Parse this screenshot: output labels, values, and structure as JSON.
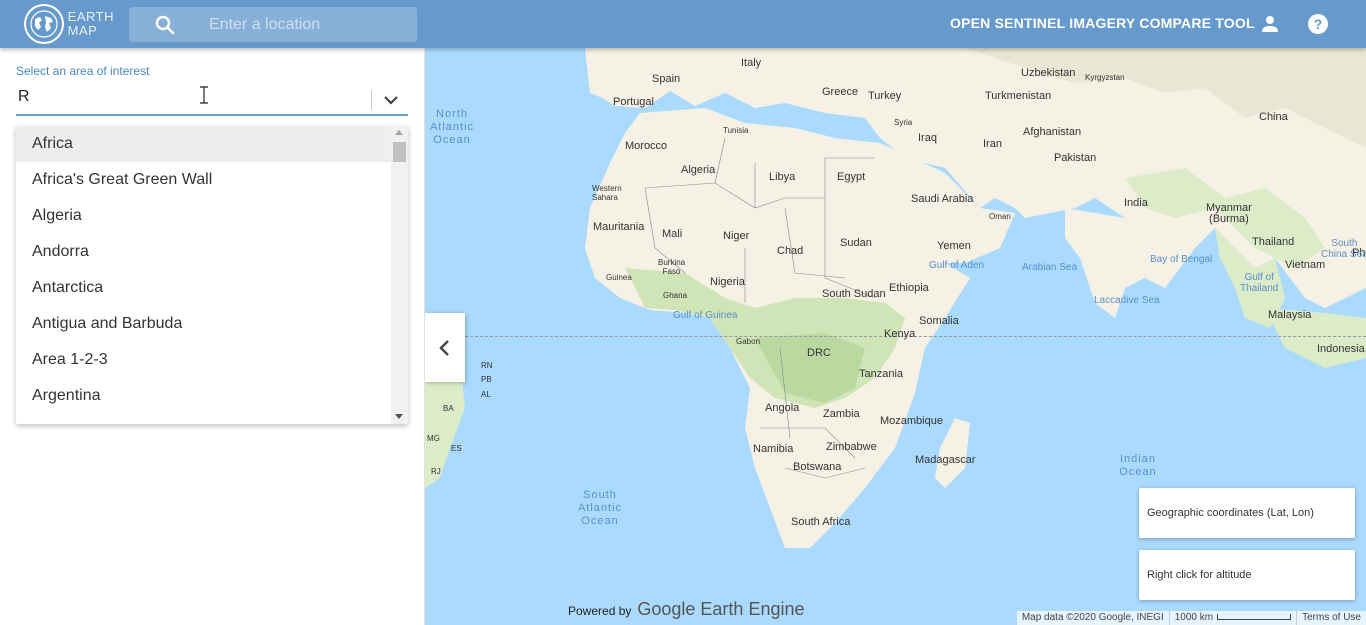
{
  "header": {
    "logo_text_line1": "EARTH",
    "logo_text_line2": "MAP",
    "search_placeholder": "Enter a location",
    "app_title": "OPEN SENTINEL IMAGERY COMPARE TOOL",
    "icons": [
      "search-icon",
      "user-icon",
      "help-icon"
    ]
  },
  "sidebar": {
    "aoi_label": "Select an area of interest",
    "aoi_value": "R",
    "dropdown_items": [
      "Africa",
      "Africa's Great Green Wall",
      "Algeria",
      "Andorra",
      "Antarctica",
      "Antigua and Barbuda",
      "Area 1-2-3",
      "Argentina"
    ]
  },
  "map": {
    "labels": {
      "spain": "Spain",
      "portugal": "Portugal",
      "italy": "Italy",
      "greece": "Greece",
      "turkey": "Turkey",
      "uzbekistan": "Uzbekistan",
      "kyrgyzstan": "Kyrgyzstan",
      "turkmenistan": "Turkmenistan",
      "syria": "Syria",
      "iraq": "Iraq",
      "afghanistan": "Afghanistan",
      "china": "China",
      "iran": "Iran",
      "pakistan": "Pakistan",
      "morocco": "Morocco",
      "tunisia": "Tunisia",
      "algeria": "Algeria",
      "libya": "Libya",
      "egypt": "Egypt",
      "saudi_arabia": "Saudi Arabia",
      "oman": "Oman",
      "india": "India",
      "myanmar": "Myanmar\n(Burma)",
      "western_sahara": "Western\nSahara",
      "mauritania": "Mauritania",
      "mali": "Mali",
      "niger": "Niger",
      "chad": "Chad",
      "sudan": "Sudan",
      "yemen": "Yemen",
      "thailand": "Thailand",
      "vietnam": "Vietnam",
      "guinea": "Guinea",
      "burkina_faso": "Burkina\nFaso",
      "nigeria": "Nigeria",
      "ghana": "Ghana",
      "south_sudan": "South Sudan",
      "ethiopia": "Ethiopia",
      "somalia": "Somalia",
      "malaysia": "Malaysia",
      "gabon": "Gabon",
      "drc": "DRC",
      "kenya": "Kenya",
      "indonesia": "Indonesia",
      "tanzania": "Tanzania",
      "angola": "Angola",
      "zambia": "Zambia",
      "mozambique": "Mozambique",
      "namibia": "Namibia",
      "zimbabwe": "Zimbabwe",
      "botswana": "Botswana",
      "madagascar": "Madagascar",
      "south_africa": "South Africa",
      "ph": "Ph",
      "rn": "RN",
      "pb": "PB",
      "al": "AL",
      "ba": "BA",
      "mg": "MG",
      "es": "ES",
      "rj": "RJ"
    },
    "water_labels": {
      "north_atlantic": "North\nAtlantic\nOcean",
      "south_atlantic": "South\nAtlantic\nOcean",
      "indian_ocean": "Indian\nOcean",
      "gulf_of_aden": "Gulf of Aden",
      "arabian_sea": "Arabian Sea",
      "bay_of_bengal": "Bay of Bengal",
      "south_china_sea": "South\nChina Sea",
      "gulf_of_thailand": "Gulf of\nThailand",
      "laccadive_sea": "Laccadive Sea",
      "gulf_of_guinea": "Gulf of Guinea"
    },
    "coords_box": "Geographic coordinates (Lat, Lon)",
    "altitude_box": "Right click for altitude",
    "powered_by": "Powered by",
    "gee": "Google Earth Engine",
    "attribution": {
      "map_data": "Map data ©2020 Google, INEGI",
      "scale": "1000 km",
      "terms": "Terms of Use"
    },
    "colors": {
      "water": "#aadaff",
      "land": "#f5f1e4",
      "vegetation": "#cfe5b8",
      "header": "#6699cc"
    }
  }
}
